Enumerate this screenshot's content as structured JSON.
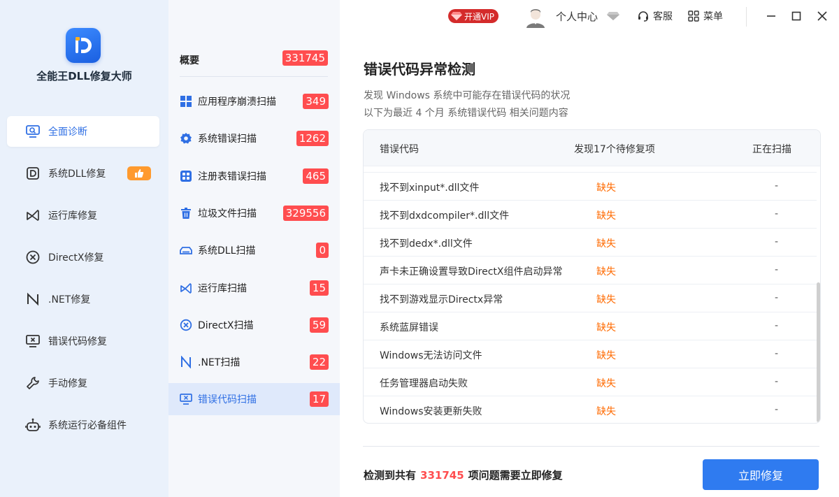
{
  "app": {
    "name": "全能王DLL修复大师"
  },
  "topbar": {
    "vip_label": "开通VIP",
    "user_center": "个人中心",
    "service": "客服",
    "menu": "菜单"
  },
  "sidebar": {
    "items": [
      {
        "label": "全面诊断",
        "icon": "monitor-search-icon",
        "active": true
      },
      {
        "label": "系统DLL修复",
        "icon": "dll-icon",
        "badge": "thumbs-up-icon"
      },
      {
        "label": "运行库修复",
        "icon": "runtime-icon"
      },
      {
        "label": "DirectX修复",
        "icon": "directx-icon"
      },
      {
        "label": ".NET修复",
        "icon": "dotnet-icon"
      },
      {
        "label": "错误代码修复",
        "icon": "error-code-icon"
      },
      {
        "label": "手动修复",
        "icon": "wrench-icon"
      },
      {
        "label": "系统运行必备组件",
        "icon": "robot-icon"
      }
    ]
  },
  "scanlist": {
    "overview": {
      "label": "概要",
      "count": "331745"
    },
    "items": [
      {
        "label": "应用程序崩溃扫描",
        "count": "349",
        "icon": "grid-icon"
      },
      {
        "label": "系统错误扫描",
        "count": "1262",
        "icon": "gear-icon"
      },
      {
        "label": "注册表错误扫描",
        "count": "465",
        "icon": "registry-icon"
      },
      {
        "label": "垃圾文件扫描",
        "count": "329556",
        "icon": "trash-icon"
      },
      {
        "label": "系统DLL扫描",
        "count": "0",
        "icon": "dll-scan-icon"
      },
      {
        "label": "运行库扫描",
        "count": "15",
        "icon": "runtime-icon"
      },
      {
        "label": "DirectX扫描",
        "count": "59",
        "icon": "directx-icon"
      },
      {
        "label": ".NET扫描",
        "count": "22",
        "icon": "dotnet-icon"
      },
      {
        "label": "错误代码扫描",
        "count": "17",
        "icon": "error-code-icon",
        "active": true
      }
    ]
  },
  "content": {
    "title": "错误代码异常检测",
    "desc1": "发现 Windows 系统中可能存在错误代码的状况",
    "desc2": "以下为最近 4 个月 系统错误代码 相关问题内容",
    "table": {
      "headers": [
        "错误代码",
        "发现17个待修复项",
        "正在扫描"
      ],
      "rows": [
        {
          "name": "找不到xinput*.dll文件",
          "status": "缺失",
          "progress": "-"
        },
        {
          "name": "找不到dxdcompiler*.dll文件",
          "status": "缺失",
          "progress": "-"
        },
        {
          "name": "找不到dedx*.dll文件",
          "status": "缺失",
          "progress": "-"
        },
        {
          "name": "声卡未正确设置导致DirectX组件启动异常",
          "status": "缺失",
          "progress": "-"
        },
        {
          "name": "找不到游戏显示Directx异常",
          "status": "缺失",
          "progress": "-"
        },
        {
          "name": "系统蓝屏错误",
          "status": "缺失",
          "progress": "-"
        },
        {
          "name": "Windows无法访问文件",
          "status": "缺失",
          "progress": "-"
        },
        {
          "name": "任务管理器启动失败",
          "status": "缺失",
          "progress": "-"
        },
        {
          "name": "Windows安装更新失败",
          "status": "缺失",
          "progress": "-"
        }
      ]
    },
    "summary_prefix": "检测到共有",
    "summary_count": "331745",
    "summary_suffix": "项问题需要立即修复",
    "repair_button": "立即修复"
  },
  "colors": {
    "accent": "#2f7bf0",
    "badge_red": "#ff4d4f",
    "status_orange": "#ff6a00",
    "sidebar_bg": "#eaf1fb"
  }
}
